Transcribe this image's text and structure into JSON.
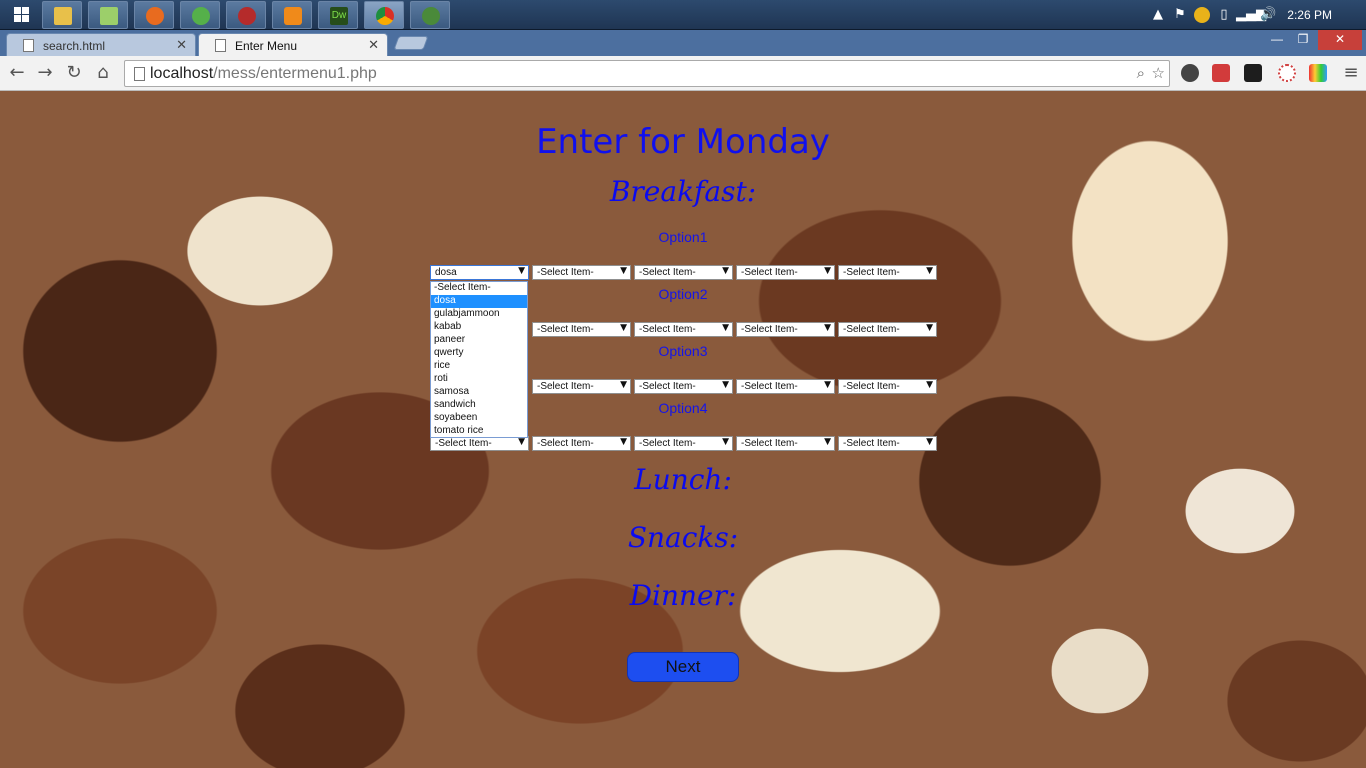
{
  "taskbar": {
    "apps": [
      "file-explorer",
      "libraries",
      "firefox",
      "globe-app",
      "bug-app",
      "media-player",
      "dreamweaver",
      "chrome",
      "network-app"
    ],
    "dreamweaver_label": "Dw",
    "clock": "2:26 PM"
  },
  "browser": {
    "tabs": [
      {
        "label": "search.html"
      },
      {
        "label": "Enter Menu"
      }
    ],
    "url_host": "localhost",
    "url_path": "/mess/entermenu1.php"
  },
  "page": {
    "title": "Enter for Monday",
    "breakfast": "Breakfast:",
    "lunch": "Lunch:",
    "snacks": "Snacks:",
    "dinner": "Dinner:",
    "options": [
      "Option1",
      "Option2",
      "Option3",
      "Option4"
    ],
    "selects": {
      "row1": [
        "dosa",
        "-Select Item-",
        "-Select Item-",
        "-Select Item-",
        "-Select Item-"
      ],
      "row2": [
        "-Select Item-",
        "-Select Item-",
        "-Select Item-",
        "-Select Item-"
      ],
      "row3": [
        "-Select Item-",
        "-Select Item-",
        "-Select Item-",
        "-Select Item-"
      ],
      "row4": [
        "-Select Item-",
        "-Select Item-",
        "-Select Item-",
        "-Select Item-",
        "-Select Item-"
      ]
    },
    "dropdown_options": [
      "-Select Item-",
      "dosa",
      "gulabjammoon",
      "kabab",
      "paneer",
      "qwerty",
      "rice",
      "roti",
      "samosa",
      "sandwich",
      "soyabeen",
      "tomato rice"
    ],
    "dropdown_selected": "dosa",
    "next_button": "Next"
  }
}
